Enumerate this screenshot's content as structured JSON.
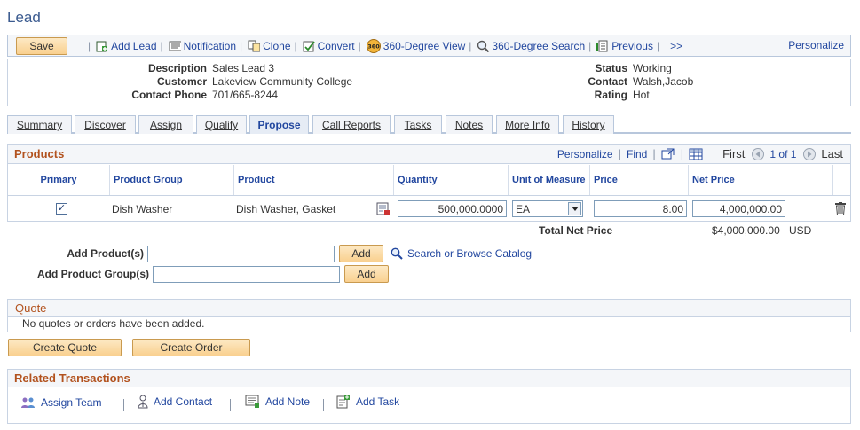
{
  "page": {
    "title": "Lead"
  },
  "toolbar": {
    "save_label": "Save",
    "items": [
      {
        "icon": "add-lead-icon",
        "label": "Add Lead"
      },
      {
        "icon": "notification-icon",
        "label": "Notification"
      },
      {
        "icon": "clone-icon",
        "label": "Clone"
      },
      {
        "icon": "convert-icon",
        "label": "Convert"
      },
      {
        "icon": "360-view-icon",
        "label": "360-Degree View"
      },
      {
        "icon": "360-search-icon",
        "label": "360-Degree Search"
      },
      {
        "icon": "previous-icon",
        "label": "Previous"
      }
    ],
    "more_label": ">>",
    "personalize_label": "Personalize"
  },
  "info": {
    "description_label": "Description",
    "description_value": "Sales Lead 3",
    "customer_label": "Customer",
    "customer_value": "Lakeview Community College",
    "phone_label": "Contact Phone",
    "phone_value": "701/665-8244",
    "status_label": "Status",
    "status_value": "Working",
    "contact_label": "Contact",
    "contact_value": "Walsh,Jacob",
    "rating_label": "Rating",
    "rating_value": "Hot"
  },
  "tabs": [
    {
      "label": "Summary"
    },
    {
      "label": "Discover"
    },
    {
      "label": "Assign"
    },
    {
      "label": "Qualify"
    },
    {
      "label": "Propose",
      "active": true
    },
    {
      "label": "Call Reports"
    },
    {
      "label": "Tasks"
    },
    {
      "label": "Notes"
    },
    {
      "label": "More Info"
    },
    {
      "label": "History"
    }
  ],
  "products": {
    "title": "Products",
    "personalize": "Personalize",
    "find": "Find",
    "first": "First",
    "range": "1 of 1",
    "last": "Last",
    "columns": {
      "primary": "Primary",
      "product_group": "Product Group",
      "product": "Product",
      "quantity": "Quantity",
      "uom": "Unit of Measure",
      "price": "Price",
      "net_price": "Net Price"
    },
    "row": {
      "primary_checked": true,
      "product_group": "Dish Washer",
      "product": "Dish Washer, Gasket",
      "quantity": "500,000.0000",
      "uom": "EA",
      "price": "8.00",
      "net_price": "4,000,000.00"
    },
    "total_label": "Total Net Price",
    "total_value": "$4,000,000.00",
    "total_currency": "USD"
  },
  "add_products": {
    "product_label": "Add Product(s)",
    "product_group_label": "Add Product Group(s)",
    "add_label": "Add",
    "search_label": "Search or Browse Catalog"
  },
  "quote": {
    "title": "Quote",
    "empty_text": "No quotes or orders have been added.",
    "create_quote": "Create Quote",
    "create_order": "Create Order"
  },
  "related": {
    "title": "Related Transactions",
    "assign_team": "Assign Team",
    "add_contact": "Add Contact",
    "add_note": "Add Note",
    "add_task": "Add Task"
  }
}
